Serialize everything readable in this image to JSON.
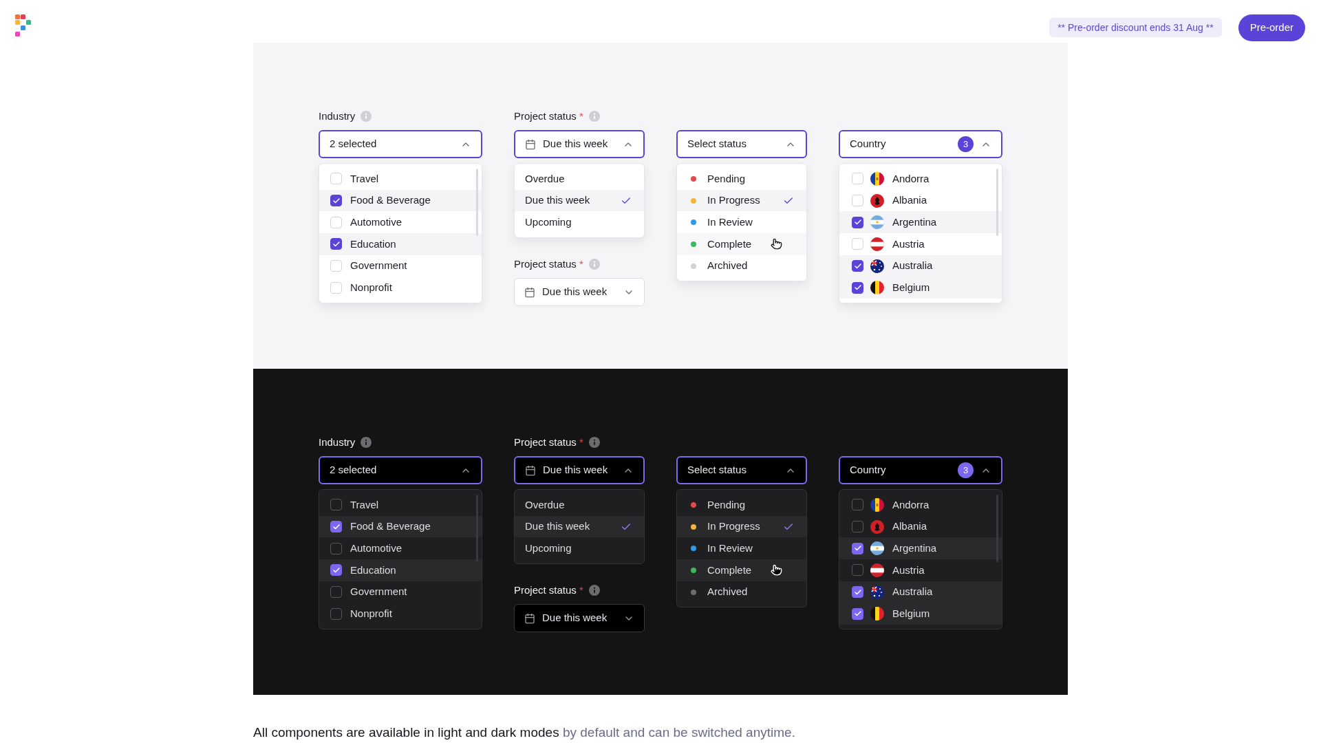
{
  "header": {
    "promo": "** Pre-order discount ends 31 Aug **",
    "preorder_button": "Pre-order"
  },
  "panels": [
    {
      "kind": "light",
      "industry": {
        "label": "Industry",
        "value": "2 selected",
        "expanded": true,
        "options": [
          {
            "label": "Travel",
            "checked": false
          },
          {
            "label": "Food & Beverage",
            "checked": true
          },
          {
            "label": "Automotive",
            "checked": false
          },
          {
            "label": "Education",
            "checked": true
          },
          {
            "label": "Government",
            "checked": false
          },
          {
            "label": "Nonprofit",
            "checked": false
          }
        ]
      },
      "due": {
        "label": "Project status",
        "required_mark": "*",
        "value": "Due this week",
        "expanded": true,
        "options": [
          {
            "label": "Overdue",
            "selected": false
          },
          {
            "label": "Due this week",
            "selected": true
          },
          {
            "label": "Upcoming",
            "selected": false
          }
        ]
      },
      "due_closed": {
        "label": "Project status",
        "required_mark": "*",
        "value": "Due this week",
        "expanded": false
      },
      "status": {
        "text": "Select status",
        "expanded": true,
        "options": [
          {
            "label": "Pending",
            "color": "#e5484d",
            "selected": false,
            "hovered": false
          },
          {
            "label": "In Progress",
            "color": "#f5b43a",
            "selected": true,
            "hovered": false
          },
          {
            "label": "In Review",
            "color": "#2f9bf0",
            "selected": false,
            "hovered": false
          },
          {
            "label": "Complete",
            "color": "#3cba5c",
            "selected": false,
            "hovered": true
          },
          {
            "label": "Archived",
            "color": "#d1d1d8",
            "selected": false,
            "hovered": false
          }
        ]
      },
      "country": {
        "text": "Country",
        "count": "3",
        "expanded": true,
        "options": [
          {
            "label": "Andorra",
            "kind": "andorra",
            "checked": false
          },
          {
            "label": "Albania",
            "kind": "albania",
            "checked": false
          },
          {
            "label": "Argentina",
            "kind": "argentina",
            "checked": true
          },
          {
            "label": "Austria",
            "kind": "austria",
            "checked": false
          },
          {
            "label": "Australia",
            "kind": "australia",
            "checked": true
          },
          {
            "label": "Belgium",
            "kind": "belgium",
            "checked": true
          }
        ]
      }
    },
    {
      "kind": "dark",
      "industry": {
        "label": "Industry",
        "value": "2 selected",
        "expanded": true,
        "options": [
          {
            "label": "Travel",
            "checked": false
          },
          {
            "label": "Food & Beverage",
            "checked": true
          },
          {
            "label": "Automotive",
            "checked": false
          },
          {
            "label": "Education",
            "checked": true
          },
          {
            "label": "Government",
            "checked": false
          },
          {
            "label": "Nonprofit",
            "checked": false
          }
        ]
      },
      "due": {
        "label": "Project status",
        "required_mark": "*",
        "value": "Due this week",
        "expanded": true,
        "options": [
          {
            "label": "Overdue",
            "selected": false
          },
          {
            "label": "Due this week",
            "selected": true
          },
          {
            "label": "Upcoming",
            "selected": false
          }
        ]
      },
      "due_closed": {
        "label": "Project status",
        "required_mark": "*",
        "value": "Due this week",
        "expanded": false
      },
      "status": {
        "text": "Select status",
        "expanded": true,
        "options": [
          {
            "label": "Pending",
            "color": "#e5484d",
            "selected": false,
            "hovered": false
          },
          {
            "label": "In Progress",
            "color": "#f5b43a",
            "selected": true,
            "hovered": false
          },
          {
            "label": "In Review",
            "color": "#2f9bf0",
            "selected": false,
            "hovered": false
          },
          {
            "label": "Complete",
            "color": "#3cba5c",
            "selected": false,
            "hovered": true
          },
          {
            "label": "Archived",
            "color": "#6b6b70",
            "selected": false,
            "hovered": false
          }
        ]
      },
      "country": {
        "text": "Country",
        "count": "3",
        "expanded": true,
        "options": [
          {
            "label": "Andorra",
            "kind": "andorra",
            "checked": false
          },
          {
            "label": "Albania",
            "kind": "albania",
            "checked": false
          },
          {
            "label": "Argentina",
            "kind": "argentina",
            "checked": true
          },
          {
            "label": "Austria",
            "kind": "austria",
            "checked": false
          },
          {
            "label": "Australia",
            "kind": "australia",
            "checked": true
          },
          {
            "label": "Belgium",
            "kind": "belgium",
            "checked": true
          }
        ]
      }
    }
  ],
  "footer": {
    "lead": "All components are available in light and dark modes",
    "rest": "by default and can be switched anytime."
  }
}
